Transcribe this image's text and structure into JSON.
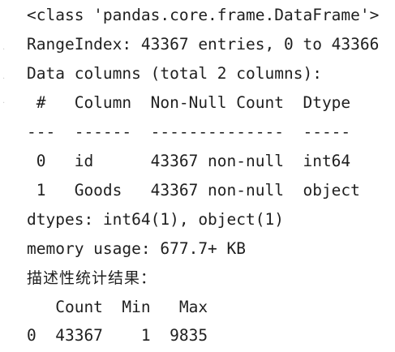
{
  "output": {
    "info_lines": [
      "<class 'pandas.core.frame.DataFrame'>",
      "RangeIndex: 43367 entries, 0 to 43366",
      "Data columns (total 2 columns):",
      " #   Column  Non-Null Count  Dtype",
      "---  ------  --------------  -----",
      " 0   id      43367 non-null  int64",
      " 1   Goods   43367 non-null  object",
      "dtypes: int64(1), object(1)",
      "memory usage: 677.7+ KB"
    ],
    "stats_label": "描述性统计结果：",
    "stats_header": "   Count  Min   Max",
    "stats_row": "0  43367    1  9835"
  }
}
